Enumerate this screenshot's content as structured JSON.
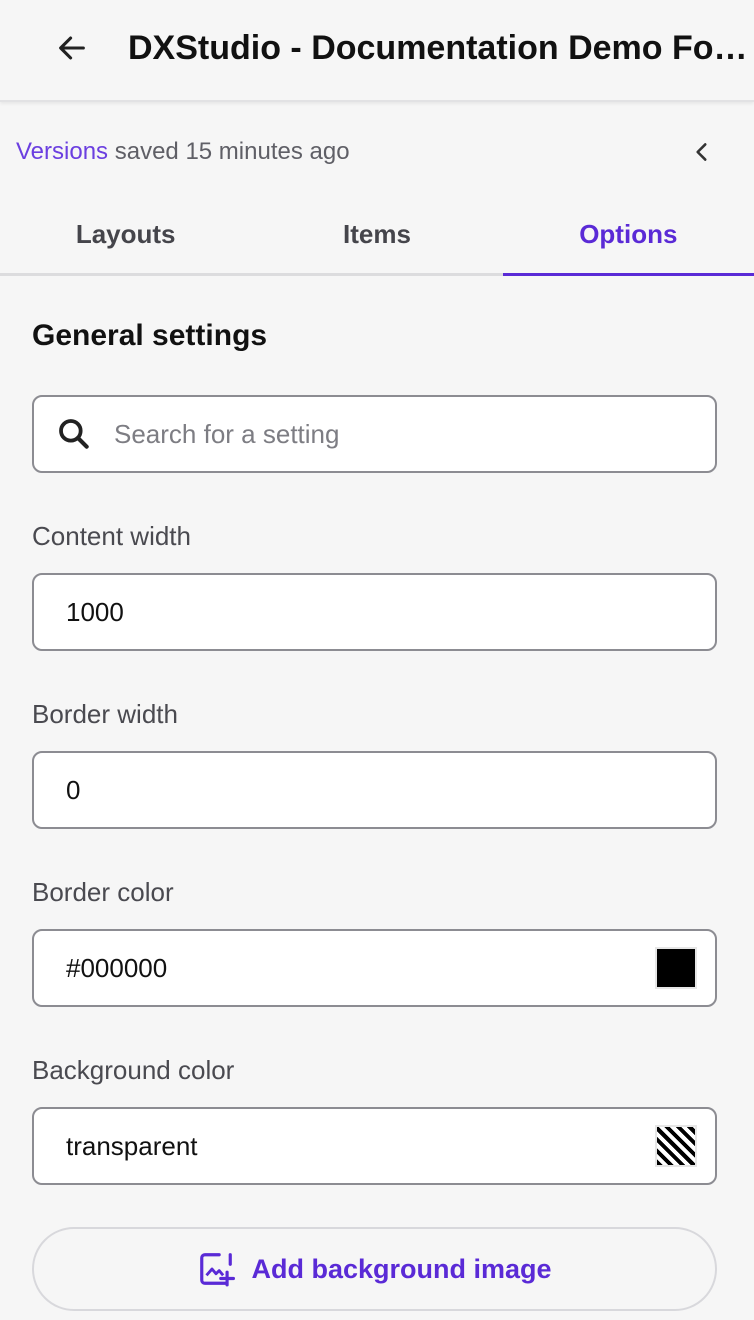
{
  "header": {
    "back_icon": "arrow-left-icon",
    "title": "DXStudio - Documentation Demo Form"
  },
  "versions": {
    "link_label": "Versions",
    "status_text": " saved 15 minutes ago",
    "collapse_icon": "chevron-left-icon"
  },
  "tabs": [
    {
      "label": "Layouts",
      "active": false
    },
    {
      "label": "Items",
      "active": false
    },
    {
      "label": "Options",
      "active": true
    }
  ],
  "general_settings": {
    "title": "General settings",
    "search": {
      "placeholder": "Search for a setting",
      "value": "",
      "icon": "search-icon"
    },
    "fields": {
      "content_width": {
        "label": "Content width",
        "value": "1000"
      },
      "border_width": {
        "label": "Border width",
        "value": "0"
      },
      "border_color": {
        "label": "Border color",
        "value": "#000000",
        "swatch": "#000000"
      },
      "background_color": {
        "label": "Background color",
        "value": "transparent",
        "swatch": "transparent"
      }
    },
    "add_background_image": {
      "label": "Add background image",
      "icon": "add-image-icon"
    }
  },
  "colors": {
    "accent": "#5a2ad6",
    "link": "#6b3fe0",
    "background": "#f6f6f6"
  }
}
